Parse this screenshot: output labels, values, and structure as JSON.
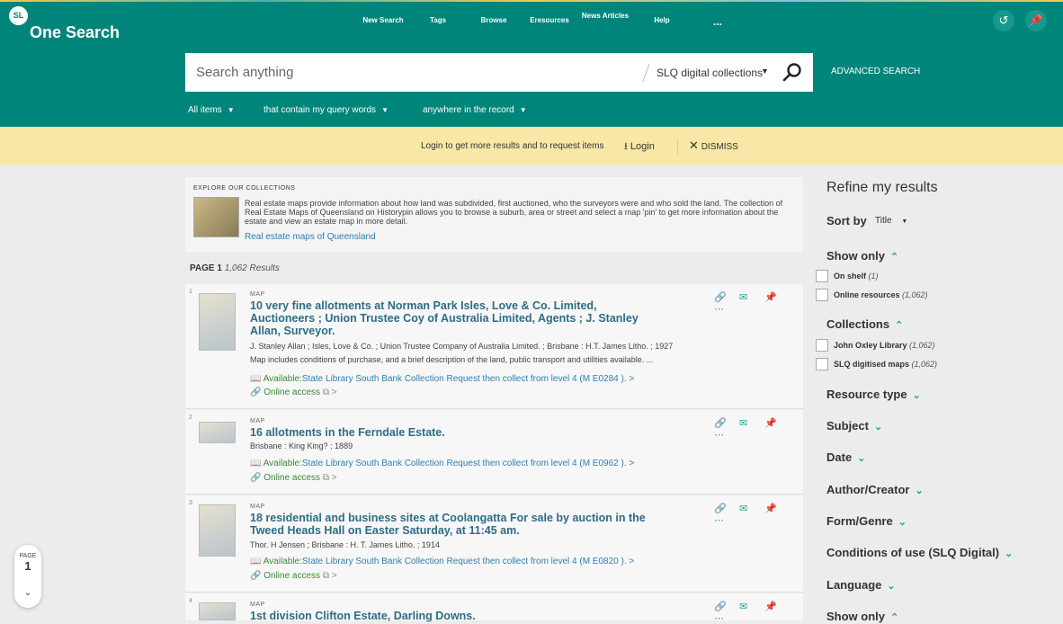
{
  "header": {
    "logo_badge": "SL",
    "logo_text": "One Search",
    "nav": [
      "New Search",
      "Tags",
      "Browse",
      "Eresources",
      "News Articles",
      "Help",
      "..."
    ],
    "history_icon": "history-icon",
    "pin_icon": "pin-icon"
  },
  "search": {
    "placeholder": "Search anything",
    "scope": "SLQ digital collections",
    "advanced": "ADVANCED SEARCH",
    "filters": [
      "All items",
      "that contain my query words",
      "anywhere in the record"
    ]
  },
  "banner": {
    "text": "Login to get more results and to request items",
    "login": "Login",
    "dismiss": "DISMISS"
  },
  "explore": {
    "title": "EXPLORE OUR COLLECTIONS",
    "body": "Real estate maps provide information about how land was subdivided, first auctioned, who the surveyors were and who sold the land. The collection of Real Estate Maps of Queensland on Historypin allows you to browse a suburb, area or street and select a map 'pin' to get more information about the estate and view an estate map in more detail.",
    "link": "Real estate maps of Queensland"
  },
  "results": {
    "page_label": "PAGE 1",
    "count": "1,062 Results",
    "items": [
      {
        "num": "1",
        "type": "MAP",
        "title": "10 very fine allotments at Norman Park Isles, Love & Co. Limited, Auctioneers ; Union Trustee Coy of Australia Limited, Agents ; J. Stanley Allan, Surveyor.",
        "meta": "J. Stanley Allan ; Isles, Love & Co. ; Union Trustee Company of Australia Limited. ; Brisbane : H.T. James Litho. ; 1927",
        "desc": "Map includes conditions of purchase, and a brief description of the land, public transport and utilities available. ...",
        "avail": "Available:",
        "avail_loc": "State Library South Bank Collection  Request then collect from level 4 (M E0284 ).  >",
        "online": "Online access"
      },
      {
        "num": "2",
        "type": "MAP",
        "title": "16 allotments in the Ferndale Estate.",
        "meta": "Brisbane : King King? ; 1889",
        "avail": "Available:",
        "avail_loc": "State Library South Bank Collection  Request then collect from level 4 (M E0962 ).  >",
        "online": "Online access"
      },
      {
        "num": "3",
        "type": "MAP",
        "title": "18 residential and business sites at Coolangatta For sale by auction in the Tweed Heads Hall on Easter Saturday, at 11:45 am.",
        "meta": "Thor. H Jensen ; Brisbane : H. T. James Litho. ; 1914",
        "avail": "Available:",
        "avail_loc": "State Library South Bank Collection  Request then collect from level 4 (M E0820 ).  >",
        "online": "Online access"
      },
      {
        "num": "4",
        "type": "MAP",
        "title": "1st division Clifton Estate, Darling Downs."
      }
    ]
  },
  "refine": {
    "title": "Refine my results",
    "sort_label": "Sort by",
    "sort_value": "Title",
    "show_only": "Show only",
    "show_opts": [
      {
        "label": "On shelf",
        "count": "(1)"
      },
      {
        "label": "Online resources",
        "count": "(1,062)"
      }
    ],
    "collections": "Collections",
    "coll_opts": [
      {
        "label": "John Oxley Library",
        "count": "(1,062)"
      },
      {
        "label": "SLQ digitised maps",
        "count": "(1,062)"
      }
    ],
    "facets": [
      "Resource type",
      "Subject",
      "Date",
      "Author/Creator",
      "Form/Genre",
      "Conditions of use (SLQ Digital)",
      "Language",
      "Show only"
    ]
  },
  "pager": {
    "label": "PAGE",
    "number": "1"
  }
}
